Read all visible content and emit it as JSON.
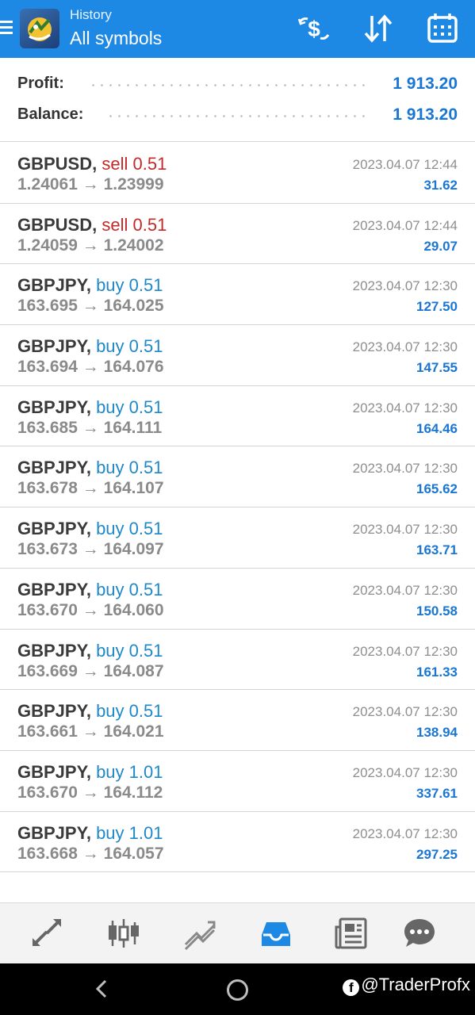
{
  "header": {
    "subtitle": "History",
    "title": "All symbols",
    "menu_icon": "hamburger-menu-icon",
    "logo_icon": "metatrader-logo-icon",
    "actions": [
      {
        "name": "deposit-withdraw-icon"
      },
      {
        "name": "sort-icon"
      },
      {
        "name": "calendar-icon"
      }
    ]
  },
  "summary": {
    "profit_label": "Profit:",
    "profit_value": "1 913.20",
    "balance_label": "Balance:",
    "balance_value": "1 913.20"
  },
  "trades": [
    {
      "symbol": "GBPUSD,",
      "type": "sell",
      "volume": "sell 0.51",
      "open": "1.24061",
      "close": "1.23999",
      "time": "2023.04.07 12:44",
      "profit": "31.62"
    },
    {
      "symbol": "GBPUSD,",
      "type": "sell",
      "volume": "sell 0.51",
      "open": "1.24059",
      "close": "1.24002",
      "time": "2023.04.07 12:44",
      "profit": "29.07"
    },
    {
      "symbol": "GBPJPY,",
      "type": "buy",
      "volume": "buy 0.51",
      "open": "163.695",
      "close": "164.025",
      "time": "2023.04.07 12:30",
      "profit": "127.50"
    },
    {
      "symbol": "GBPJPY,",
      "type": "buy",
      "volume": "buy 0.51",
      "open": "163.694",
      "close": "164.076",
      "time": "2023.04.07 12:30",
      "profit": "147.55"
    },
    {
      "symbol": "GBPJPY,",
      "type": "buy",
      "volume": "buy 0.51",
      "open": "163.685",
      "close": "164.111",
      "time": "2023.04.07 12:30",
      "profit": "164.46"
    },
    {
      "symbol": "GBPJPY,",
      "type": "buy",
      "volume": "buy 0.51",
      "open": "163.678",
      "close": "164.107",
      "time": "2023.04.07 12:30",
      "profit": "165.62"
    },
    {
      "symbol": "GBPJPY,",
      "type": "buy",
      "volume": "buy 0.51",
      "open": "163.673",
      "close": "164.097",
      "time": "2023.04.07 12:30",
      "profit": "163.71"
    },
    {
      "symbol": "GBPJPY,",
      "type": "buy",
      "volume": "buy 0.51",
      "open": "163.670",
      "close": "164.060",
      "time": "2023.04.07 12:30",
      "profit": "150.58"
    },
    {
      "symbol": "GBPJPY,",
      "type": "buy",
      "volume": "buy 0.51",
      "open": "163.669",
      "close": "164.087",
      "time": "2023.04.07 12:30",
      "profit": "161.33"
    },
    {
      "symbol": "GBPJPY,",
      "type": "buy",
      "volume": "buy 0.51",
      "open": "163.661",
      "close": "164.021",
      "time": "2023.04.07 12:30",
      "profit": "138.94"
    },
    {
      "symbol": "GBPJPY,",
      "type": "buy",
      "volume": "buy 1.01",
      "open": "163.670",
      "close": "164.112",
      "time": "2023.04.07 12:30",
      "profit": "337.61"
    },
    {
      "symbol": "GBPJPY,",
      "type": "buy",
      "volume": "buy 1.01",
      "open": "163.668",
      "close": "164.057",
      "time": "2023.04.07 12:30",
      "profit": "297.25"
    }
  ],
  "arrow_glyph": "→",
  "bottom_nav": [
    {
      "name": "quotes-icon",
      "active": false
    },
    {
      "name": "chart-icon",
      "active": false
    },
    {
      "name": "trade-icon",
      "active": false
    },
    {
      "name": "history-icon",
      "active": true
    },
    {
      "name": "news-icon",
      "active": false
    },
    {
      "name": "chat-icon",
      "active": false
    }
  ],
  "system_bar": {
    "watermark": "@TraderProfx"
  },
  "colors": {
    "header_bg": "#1e88e5",
    "sell": "#c62828",
    "buy": "#1e88c8",
    "profit": "#1976d2",
    "active_nav": "#1e88e5"
  }
}
